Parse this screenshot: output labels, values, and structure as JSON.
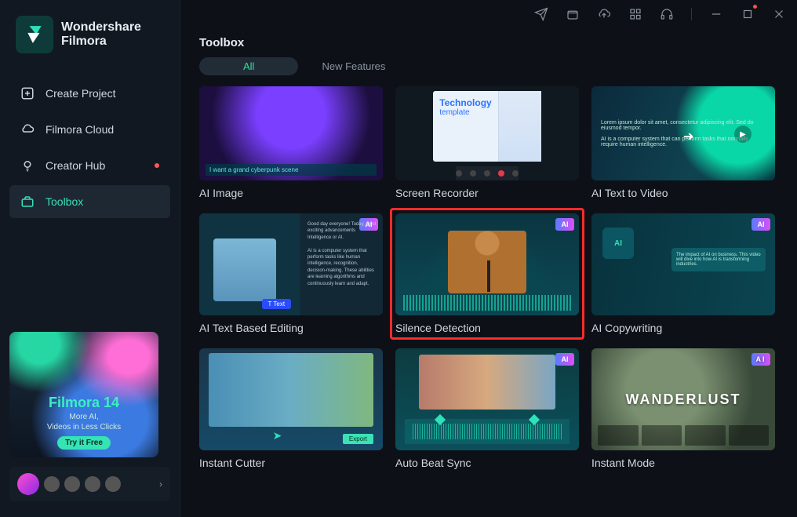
{
  "app": {
    "brand_line1": "Wondershare",
    "brand_line2": "Filmora"
  },
  "sidebar": {
    "items": [
      {
        "label": "Create Project"
      },
      {
        "label": "Filmora Cloud"
      },
      {
        "label": "Creator Hub",
        "has_dot": true
      },
      {
        "label": "Toolbox",
        "active": true
      }
    ]
  },
  "promo": {
    "title": "Filmora 14",
    "line1": "More AI,",
    "line2": "Videos in Less Clicks",
    "button": "Try it Free"
  },
  "page": {
    "title": "Toolbox",
    "tabs": {
      "active": "All",
      "other": "New Features"
    }
  },
  "cards": {
    "ai_image": {
      "caption": "AI Image",
      "prompt_text": "I want a grand cyberpunk scene"
    },
    "screen_recorder": {
      "caption": "Screen Recorder",
      "tech_title": "Technology",
      "tech_sub": "template"
    },
    "ai_text_to_video": {
      "caption": "AI Text to Video"
    },
    "ai_text_based_editing": {
      "caption": "AI Text Based Editing",
      "badge": "AI",
      "text_chip": "T Text"
    },
    "silence_detection": {
      "caption": "Silence Detection",
      "badge": "AI"
    },
    "ai_copywriting": {
      "caption": "AI Copywriting",
      "badge": "AI",
      "bubble": "The impact of AI on business. This video will dive into how AI is transforming industries."
    },
    "instant_cutter": {
      "caption": "Instant Cutter",
      "export": "Export"
    },
    "auto_beat_sync": {
      "caption": "Auto Beat Sync",
      "badge": "AI"
    },
    "instant_mode": {
      "caption": "Instant Mode",
      "badge": "AI",
      "title": "WANDERLUST"
    }
  },
  "ai_badge_text": "AI"
}
